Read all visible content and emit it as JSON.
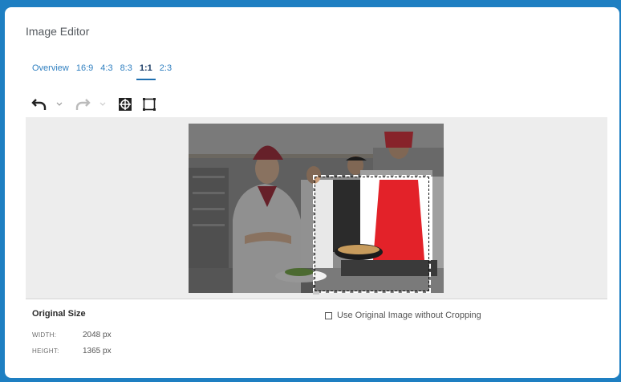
{
  "dialog": {
    "title": "Image Editor"
  },
  "tabs": [
    {
      "label": "Overview",
      "active": false
    },
    {
      "label": "16:9",
      "active": false
    },
    {
      "label": "4:3",
      "active": false
    },
    {
      "label": "8:3",
      "active": false
    },
    {
      "label": "1:1",
      "active": true
    },
    {
      "label": "2:3",
      "active": false
    }
  ],
  "toolbar": {
    "icons": [
      "undo-icon",
      "chevron-down-icon",
      "redo-icon",
      "chevron-down-icon",
      "focus-point-icon",
      "crop-frame-icon"
    ]
  },
  "image": {
    "subject": "chefs"
  },
  "info": {
    "title": "Original Size",
    "width_label": "WIDTH:",
    "width_value": "2048 px",
    "height_label": "HEIGHT:",
    "height_value": "1365 px"
  },
  "option": {
    "label": "Use Original Image without Cropping",
    "checked": false
  },
  "colors": {
    "frame": "#1e7fc2",
    "accent": "#2f7fc0",
    "active_tab": "#1f3f68",
    "workspace": "#ededed"
  }
}
